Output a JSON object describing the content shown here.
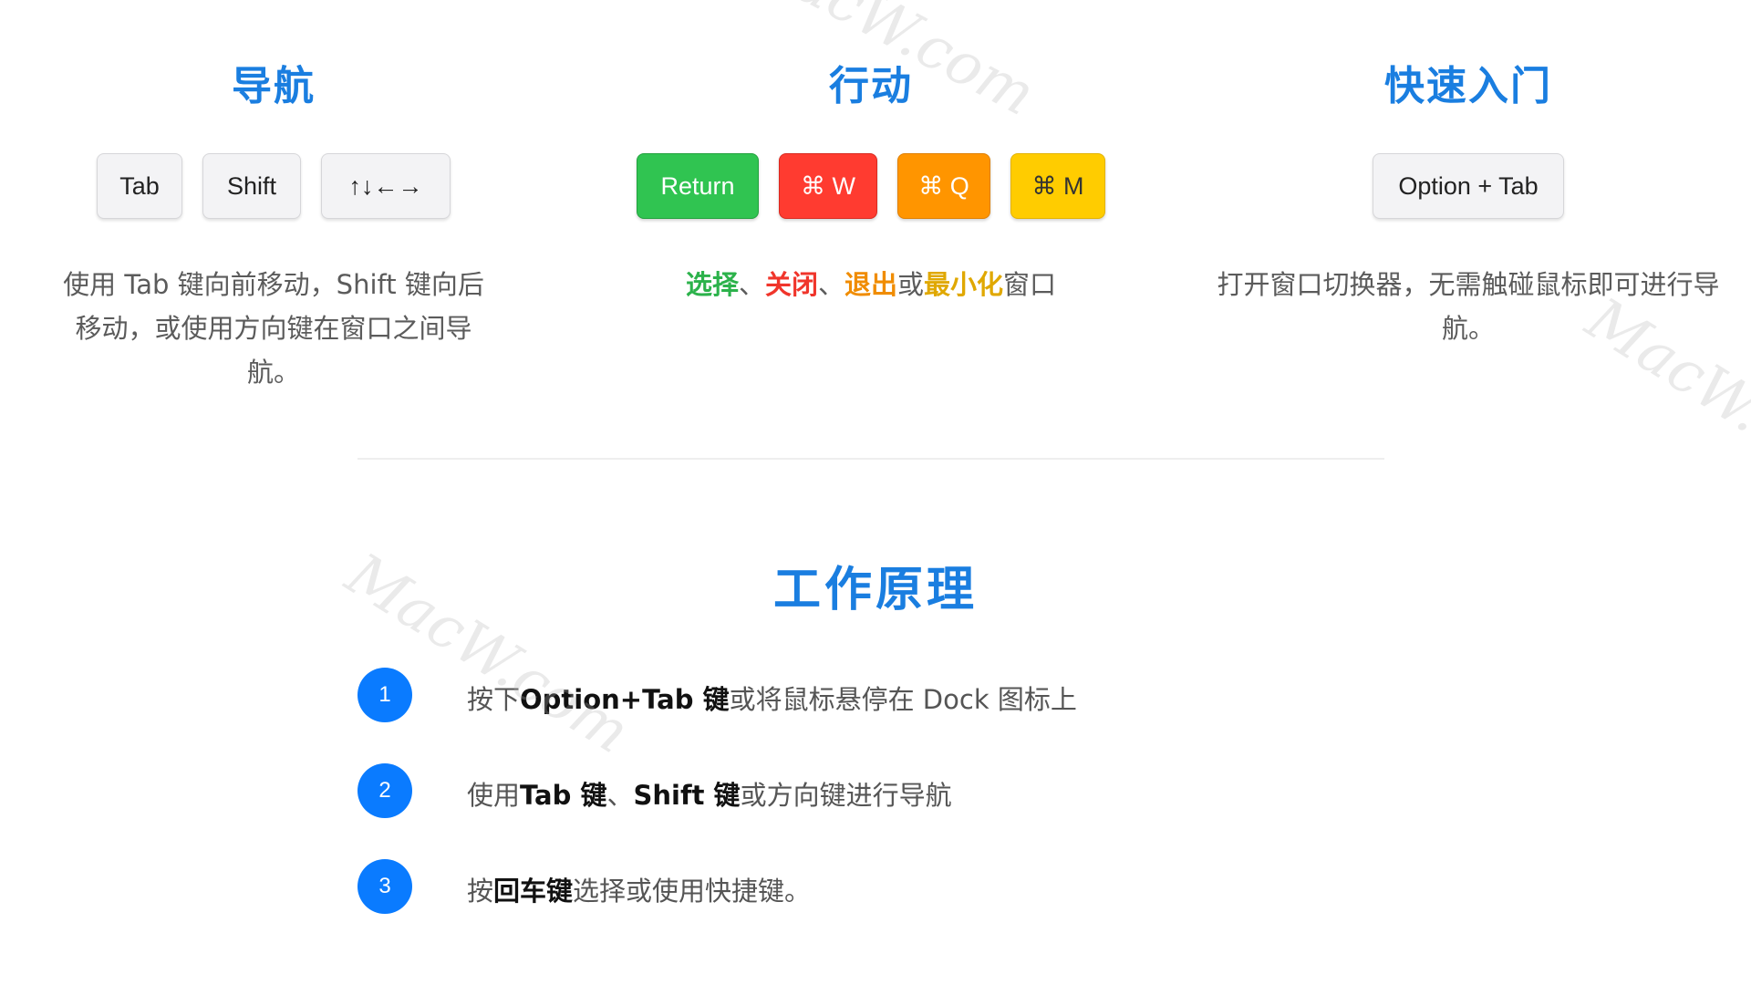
{
  "columns": {
    "navigation": {
      "title": "导航",
      "keys": [
        "Tab",
        "Shift",
        "↑↓←→"
      ],
      "description": "使用 Tab 键向前移动，Shift 键向后移动，或使用方向键在窗口之间导航。"
    },
    "actions": {
      "title": "行动",
      "keys": [
        "Return",
        "⌘ W",
        "⌘ Q",
        "⌘ M"
      ],
      "description_segments": [
        "选择",
        "、",
        "关闭",
        "、",
        "退出",
        "或",
        "最小化",
        "窗口"
      ],
      "key_colors": [
        "#30c451",
        "#ff3b30",
        "#ff9500",
        "#ffcc00"
      ]
    },
    "quick_start": {
      "title": "快速入门",
      "keys": [
        "Option + Tab"
      ],
      "description": "打开窗口切换器，无需触碰鼠标即可进行导航。"
    }
  },
  "how_it_works": {
    "title": "工作原理",
    "steps": [
      {
        "number": "1",
        "parts": [
          "按下",
          "Option+Tab 键",
          "或将鼠标悬停在 Dock 图标上"
        ]
      },
      {
        "number": "2",
        "parts": [
          "使用",
          "Tab 键",
          "、",
          "Shift 键",
          "或方向键进行导航"
        ]
      },
      {
        "number": "3",
        "parts": [
          "按",
          "回车键",
          "选择或使用快捷键。"
        ]
      }
    ]
  },
  "watermarks": [
    "MacW.com",
    "MacW.com",
    "MacW.com"
  ],
  "colors": {
    "accent": "#1a7ee0",
    "step_badge": "#0a7bff"
  }
}
